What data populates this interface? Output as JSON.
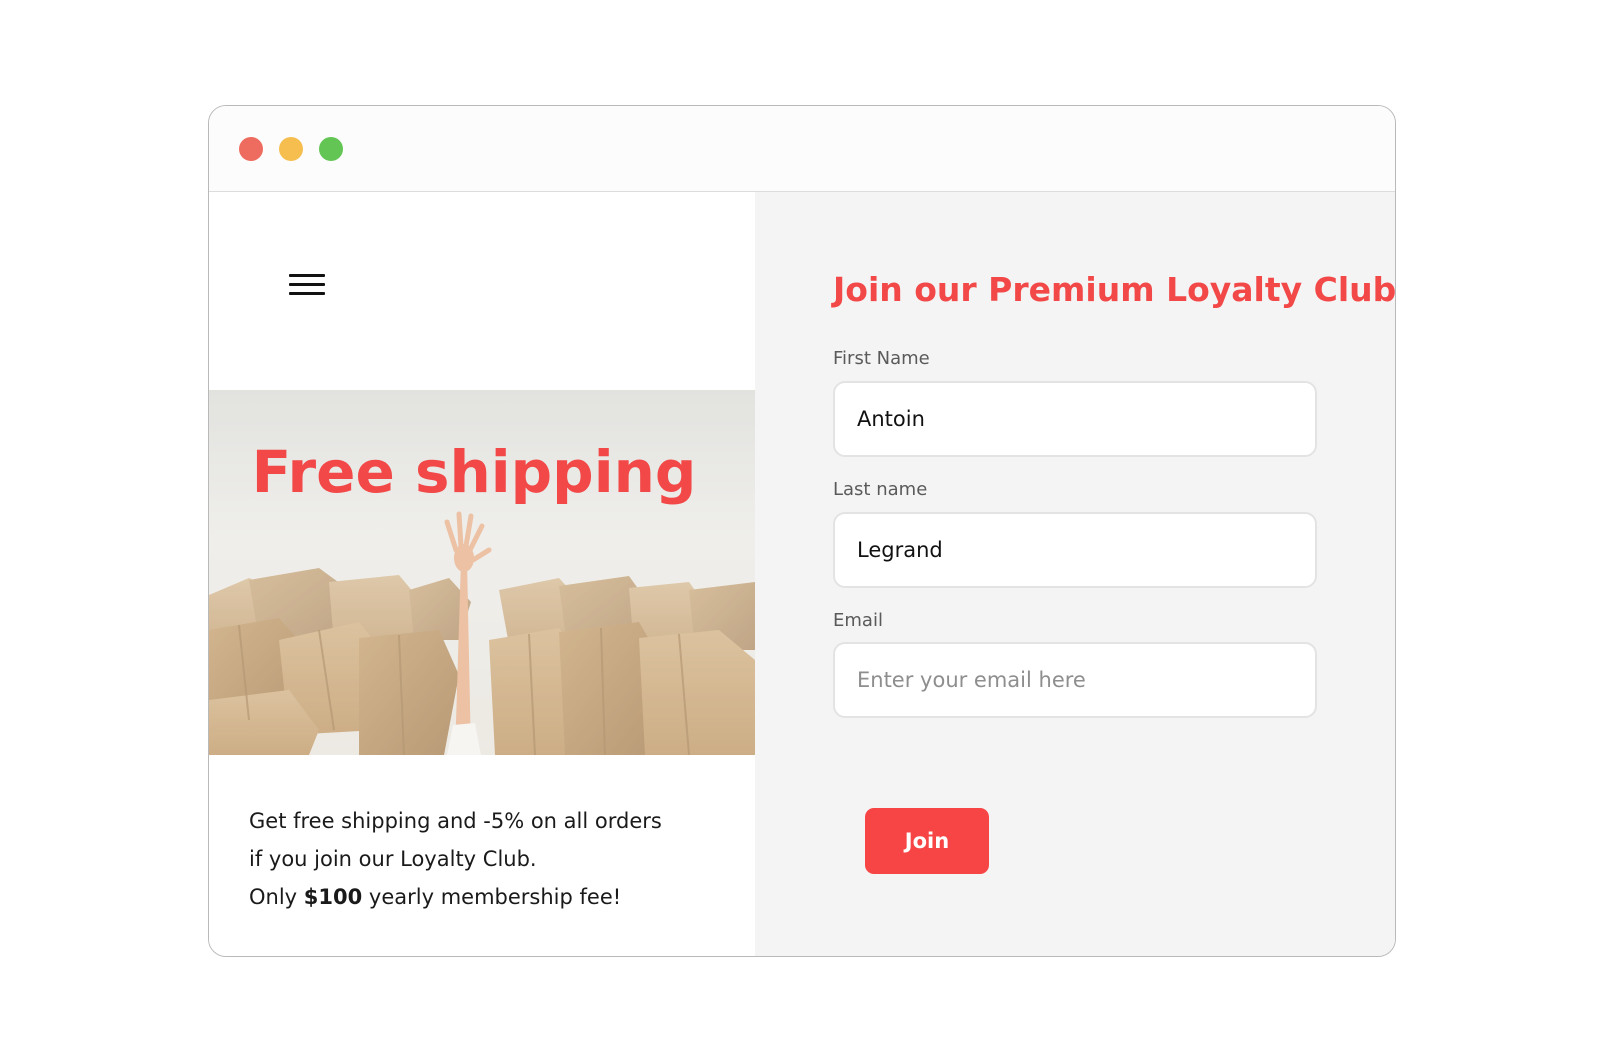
{
  "window": {
    "controls": [
      {
        "name": "close",
        "color": "#ee6b60"
      },
      {
        "name": "minimize",
        "color": "#f5be4f"
      },
      {
        "name": "maximize",
        "color": "#62c554"
      }
    ]
  },
  "left": {
    "menu_icon": "hamburger-menu-icon",
    "hero": {
      "title": "Free shipping",
      "image": "hand-reaching-out-of-pile-of-cardboard-boxes"
    },
    "promo": {
      "line1": "Get free shipping and -5% on all orders",
      "line2": "if you join our Loyalty Club.",
      "line3_prefix": "Only ",
      "line3_price": "$100",
      "line3_suffix": " yearly membership fee!"
    }
  },
  "form": {
    "title": "Join our Premium Loyalty Club",
    "first_name": {
      "label": "First Name",
      "value": "Antoin"
    },
    "last_name": {
      "label": "Last name",
      "value": "Legrand"
    },
    "email": {
      "label": "Email",
      "value": "",
      "placeholder": "Enter your email here"
    },
    "submit_label": "Join"
  },
  "colors": {
    "accent": "#f24848",
    "button": "#f74545",
    "form_background": "#f4f4f4"
  }
}
